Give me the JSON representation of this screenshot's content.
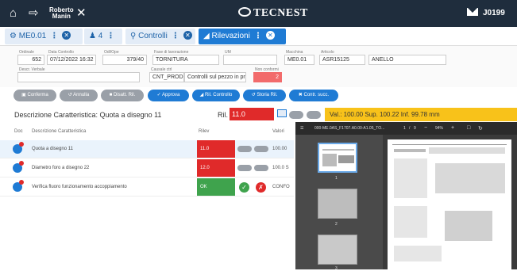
{
  "topbar": {
    "user_first": "Roberto",
    "user_last": "Manin",
    "brand": "TECNEST",
    "code": "J0199"
  },
  "tabs": [
    {
      "label": "ME0.01"
    },
    {
      "label": "4"
    },
    {
      "label": "Controlli"
    },
    {
      "label": "Rilevazioni"
    }
  ],
  "form": {
    "fields": [
      {
        "label": "Ordinale",
        "value": "652"
      },
      {
        "label": "Data Controllo",
        "value": "07/12/2022 16:32"
      },
      {
        "label": "Odl/Ope",
        "value": "379/40"
      },
      {
        "label": "Fase di lavorazione",
        "value": "TORNITURA"
      },
      {
        "label": "UM",
        "value": ""
      },
      {
        "label": "Macchina",
        "value": "ME0.01"
      },
      {
        "label": "Articolo",
        "value": "ASR15125"
      },
      {
        "label": "",
        "value": "ANELLO"
      },
      {
        "label": "Descr. Verbale",
        "value": ""
      },
      {
        "label": "Causale ctrl",
        "value": "CNT_PROD"
      },
      {
        "label": "",
        "value": "Controlli sul pezzo in pro"
      },
      {
        "label": "Non conformi",
        "value": "2"
      }
    ]
  },
  "actions": [
    {
      "label": "Conferma"
    },
    {
      "label": "Annulla"
    },
    {
      "label": "Disatt. Ril."
    },
    {
      "label": "Approva"
    },
    {
      "label": "Ril. Controllo"
    },
    {
      "label": "Storia Ril."
    },
    {
      "label": "Contr. succ."
    }
  ],
  "desc": {
    "label": "Descrizione Caratteristica: Quota a disegno 11",
    "rif_label": "Ril.",
    "rif_value": "11.0",
    "banner": "Val.: 100.00 Sup. 100.22 Inf. 99.78 mm"
  },
  "table": {
    "headers": [
      "Doc",
      "Descrizione Caratteristica",
      "Rilev",
      "Valori"
    ],
    "rows": [
      {
        "desc": "Quota a disegno 11",
        "value": "11.0",
        "extra": "100.00",
        "status": "red"
      },
      {
        "desc": "Diametro foro a disegno 22",
        "value": "12.0",
        "extra": "100.0 S",
        "status": "red"
      },
      {
        "desc": "Verifica fluoro funzionamento accoppiamento",
        "value": "OK",
        "extra": "CONFO",
        "status": "green"
      }
    ]
  },
  "viewer": {
    "filename": "000-ME.0AS_F1707.A0.00-A1.05_TO...",
    "page": "1",
    "pages": "9",
    "zoom": "94%",
    "thumb_labels": [
      "1",
      "2",
      "3"
    ]
  },
  "colors": {
    "topbar": "#1f2d3d",
    "accent": "#1f7bd4",
    "error": "#e02a2a",
    "ok": "#3fa34d",
    "banner": "#f8c21a"
  }
}
